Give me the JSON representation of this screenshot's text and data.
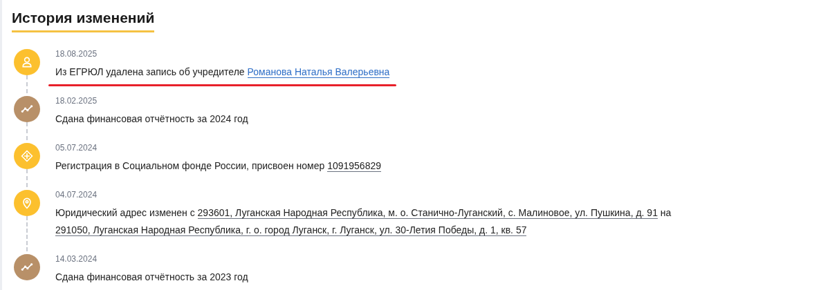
{
  "title": "История изменений",
  "events": [
    {
      "date": "18.08.2025",
      "kind": "person",
      "color": "#fcc02e",
      "underlined": true,
      "parts": [
        {
          "kind": "plain",
          "text": "Из ЕГРЮЛ удалена запись об учредителе "
        },
        {
          "kind": "link",
          "text": "Романова Наталья Валерьевна"
        }
      ]
    },
    {
      "date": "18.02.2025",
      "kind": "chart",
      "color": "#b89068",
      "underlined": false,
      "parts": [
        {
          "kind": "plain",
          "text": "Сдана финансовая отчётность за 2024 год"
        }
      ]
    },
    {
      "date": "05.07.2024",
      "kind": "diamond",
      "color": "#fcc02e",
      "underlined": false,
      "parts": [
        {
          "kind": "plain",
          "text": "Регистрация в Социальном фонде России, присвоен номер "
        },
        {
          "kind": "ref",
          "text": "1091956829"
        }
      ]
    },
    {
      "date": "04.07.2024",
      "kind": "pin",
      "color": "#fcc02e",
      "underlined": false,
      "parts": [
        {
          "kind": "plain",
          "text": "Юридический адрес изменен с "
        },
        {
          "kind": "ref",
          "text": "293601, Луганская Народная Республика, м. о. Станично-Луганский, с. Малиновое, ул. Пушкина, д. 91"
        },
        {
          "kind": "plain",
          "text": " на "
        },
        {
          "kind": "ref",
          "text": "291050, Луганская Народная "
        },
        {
          "kind": "ref",
          "text": "Республика, г. о. город Луганск, г. Луганск, ул. 30-Летия Победы, д. 1, кв. 57"
        }
      ]
    },
    {
      "date": "14.03.2024",
      "kind": "chart",
      "color": "#b89068",
      "underlined": false,
      "parts": [
        {
          "kind": "plain",
          "text": "Сдана финансовая отчётность за 2023 год"
        }
      ]
    }
  ]
}
